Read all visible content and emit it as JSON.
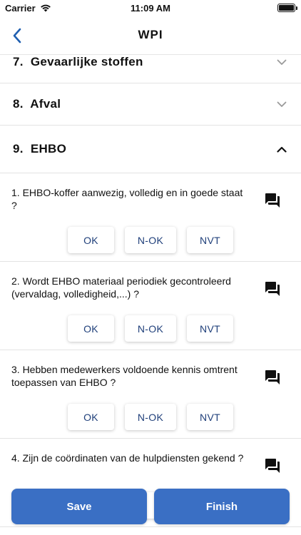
{
  "status": {
    "carrier": "Carrier",
    "time": "11:09 AM"
  },
  "nav": {
    "title": "WPI",
    "back_icon": "chevron-left-icon"
  },
  "sections": [
    {
      "number": "7.",
      "title": "Gevaarlijke stoffen",
      "expanded": false
    },
    {
      "number": "8.",
      "title": "Afval",
      "expanded": false
    },
    {
      "number": "9.",
      "title": "EHBO",
      "expanded": true
    }
  ],
  "questions": [
    {
      "text": "1. EHBO-koffer aanwezig, volledig en in goede staat ?"
    },
    {
      "text": "2. Wordt EHBO materiaal periodiek gecontroleerd (vervaldag, volledigheid,...) ?"
    },
    {
      "text": "3. Hebben medewerkers voldoende kennis omtrent toepassen van EHBO ?"
    },
    {
      "text": "4. Zijn de coördinaten van de hulpdiensten gekend ?"
    }
  ],
  "answer_options": [
    "OK",
    "N-OK",
    "NVT"
  ],
  "actions": {
    "save": "Save",
    "finish": "Finish"
  },
  "colors": {
    "accent": "#3a6fc4",
    "answer_text": "#1f3f7a",
    "nav_icon": "#1f5fb0"
  }
}
